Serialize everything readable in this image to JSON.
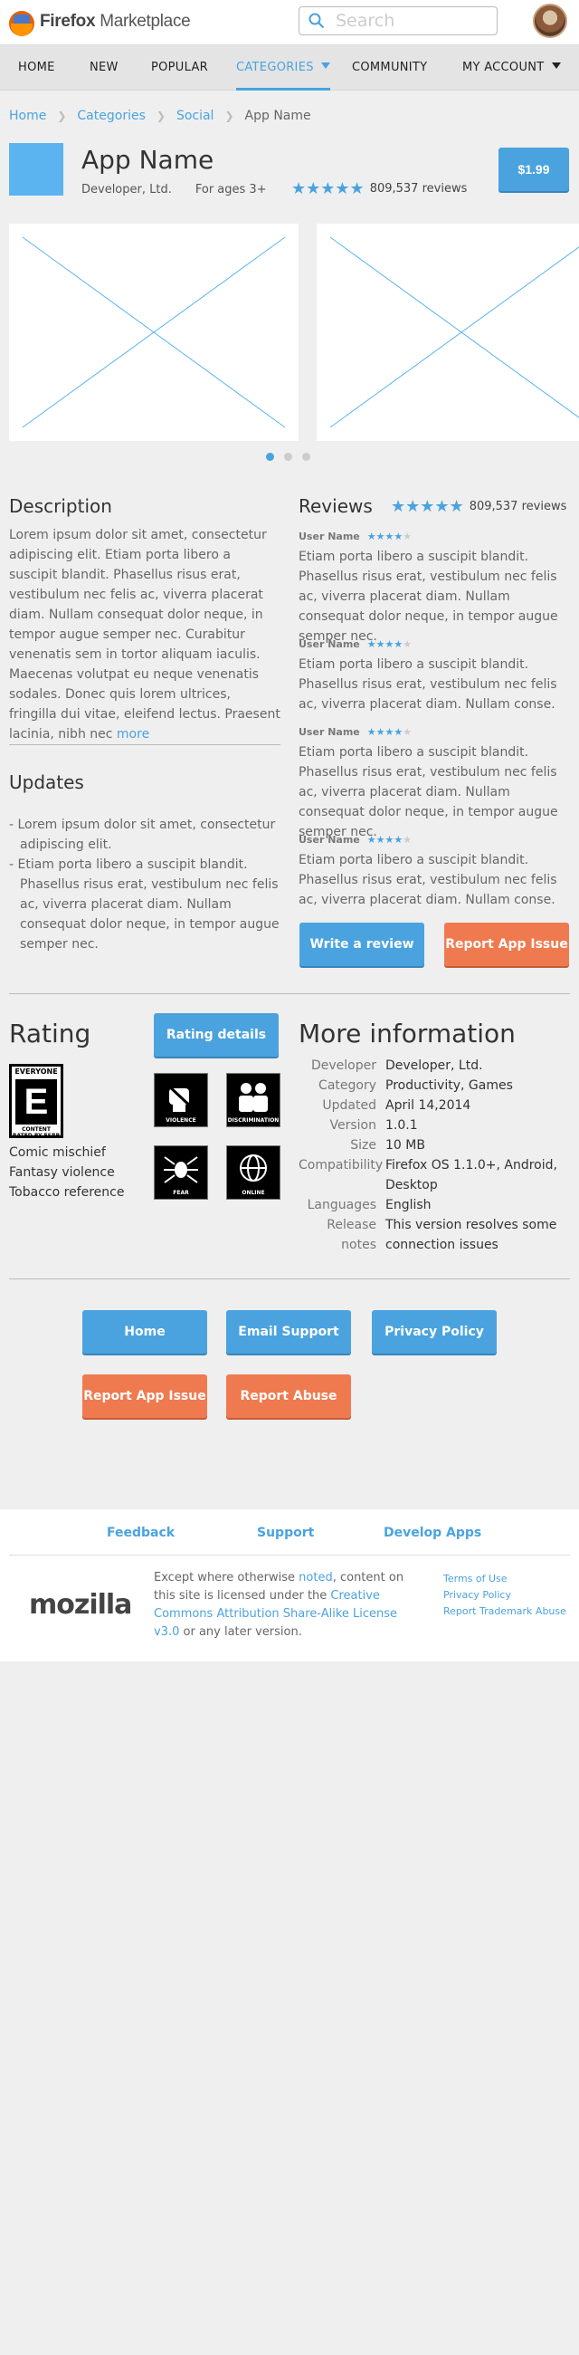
{
  "header": {
    "brand_bold": "Firefox",
    "brand_rest": " Marketplace",
    "search_placeholder": "Search"
  },
  "nav": {
    "items": [
      {
        "label": "HOME"
      },
      {
        "label": "NEW"
      },
      {
        "label": "POPULAR"
      },
      {
        "label": "CATEGORIES"
      },
      {
        "label": "COMMUNITY"
      },
      {
        "label": "MY ACCOUNT"
      }
    ]
  },
  "breadcrumb": {
    "items": [
      "Home",
      "Categories",
      "Social"
    ],
    "current": "App Name"
  },
  "app": {
    "name": "App Name",
    "developer": "Developer, Ltd.",
    "age": "For ages 3+",
    "reviews_count": "809,537 reviews",
    "price": "$1.99",
    "star_rating": 5
  },
  "gallery": {
    "dots": 3,
    "active_dot": 0
  },
  "description": {
    "title": "Description",
    "text": "Lorem ipsum dolor sit amet, consectetur adipiscing elit. Etiam porta libero a suscipit blandit. Phasellus risus erat, vestibulum nec felis ac, viverra placerat diam. Nullam consequat dolor neque, in tempor augue semper nec. Curabitur venenatis sem in tortor aliquam iaculis. Maecenas volutpat eu neque venenatis sodales. Donec quis lorem ultrices, fringilla dui vitae, eleifend lectus. Praesent lacinia, nibh nec",
    "more": "more"
  },
  "updates": {
    "title": "Updates",
    "items": [
      "- Lorem ipsum dolor sit amet, consectetur adipiscing elit.",
      "- Etiam porta libero a suscipit blandit. Phasellus risus erat, vestibulum nec felis ac, viverra placerat diam. Nullam consequat dolor neque, in tempor augue semper nec."
    ]
  },
  "reviews": {
    "title": "Reviews",
    "count": "809,537 reviews",
    "items": [
      {
        "user": "User Name",
        "stars": 4,
        "text": "Etiam porta libero a suscipit blandit. Phasellus risus erat, vestibulum nec felis ac, viverra placerat diam. Nullam consequat dolor neque, in tempor augue semper nec."
      },
      {
        "user": "User Name",
        "stars": 4,
        "text": "Etiam porta libero a suscipit blandit. Phasellus risus erat, vestibulum nec felis ac, viverra placerat diam. Nullam conse."
      },
      {
        "user": "User Name",
        "stars": 4,
        "text": "Etiam porta libero a suscipit blandit. Phasellus risus erat, vestibulum nec felis ac, viverra placerat diam. Nullam consequat dolor neque, in tempor augue semper nec."
      },
      {
        "user": "User Name",
        "stars": 4,
        "text": "Etiam porta libero a suscipit blandit. Phasellus risus erat, vestibulum nec felis ac, viverra placerat diam. Nullam conse."
      }
    ],
    "write_label": "Write a review",
    "report_label": "Report App Issue"
  },
  "rating": {
    "title": "Rating",
    "details_label": "Rating details",
    "esrb_top": "EVERYONE",
    "esrb_letter": "E",
    "esrb_bottom": "CONTENT RATED BY ESRB",
    "descriptors": [
      "VIOLENCE",
      "DISCRIMINATION",
      "FEAR",
      "ONLINE"
    ],
    "content": [
      "Comic mischief",
      "Fantasy violence",
      "Tobacco reference"
    ]
  },
  "more_info": {
    "title": "More information",
    "rows": [
      {
        "key": "Developer",
        "value": "Developer, Ltd."
      },
      {
        "key": "Category",
        "value": "Productivity, Games"
      },
      {
        "key": "Updated",
        "value": "April 14,2014"
      },
      {
        "key": "Version",
        "value": "1.0.1"
      },
      {
        "key": "Size",
        "value": "10 MB"
      },
      {
        "key": "Compatibility",
        "value": "Firefox OS 1.1.0+, Android, Desktop"
      },
      {
        "key": "Languages",
        "value": "English"
      },
      {
        "key": "Release notes",
        "value": "This version resolves some connection issues"
      }
    ]
  },
  "actions": {
    "home": "Home",
    "email": "Email Support",
    "privacy": "Privacy Policy",
    "report_issue": "Report App Issue",
    "report_abuse": "Report Abuse"
  },
  "footer": {
    "links": [
      "Feedback",
      "Support",
      "Develop Apps"
    ],
    "mozilla": "mozilla",
    "legal_1": "Except where otherwise ",
    "legal_noted": "noted",
    "legal_2": ", content on this site is licensed under the ",
    "legal_license": "Creative Commons Attribution Share-Alike License v3.0",
    "legal_3": " or any later version.",
    "legal_links": [
      "Terms of Use",
      "Privacy Policy",
      "Report Trademark Abuse"
    ]
  },
  "colors": {
    "accent": "#4aa3df",
    "warning": "#f07a4f",
    "page_bg": "#efefef"
  }
}
